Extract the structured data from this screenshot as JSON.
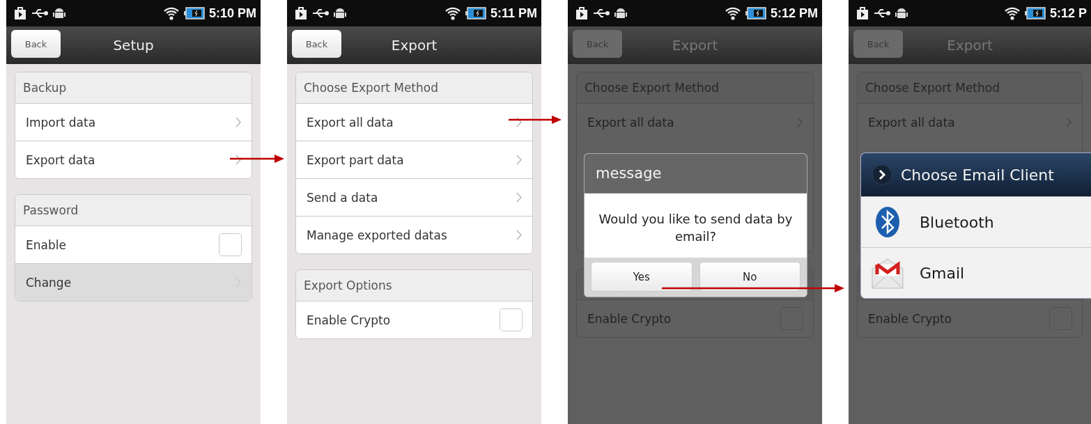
{
  "screens": [
    {
      "dimmed": false,
      "status_bar": {
        "time": "5:10 PM"
      },
      "title_bar": {
        "back": "Back",
        "title": "Setup"
      },
      "sections": [
        {
          "title": "Backup",
          "items": [
            {
              "kind": "link",
              "label": "Import data",
              "disabled": false
            },
            {
              "kind": "link",
              "label": "Export data",
              "disabled": false
            }
          ]
        },
        {
          "title": "Password",
          "items": [
            {
              "kind": "checkbox",
              "label": "Enable",
              "checked": false
            },
            {
              "kind": "link",
              "label": "Change",
              "disabled": true
            }
          ]
        }
      ]
    },
    {
      "dimmed": false,
      "status_bar": {
        "time": "5:11 PM"
      },
      "title_bar": {
        "back": "Back",
        "title": "Export"
      },
      "sections": [
        {
          "title": "Choose Export Method",
          "items": [
            {
              "kind": "link",
              "label": "Export all data",
              "disabled": false
            },
            {
              "kind": "link",
              "label": "Export part data",
              "disabled": false
            },
            {
              "kind": "link",
              "label": "Send a data",
              "disabled": false
            },
            {
              "kind": "link",
              "label": "Manage exported datas",
              "disabled": false
            }
          ]
        },
        {
          "title": "Export Options",
          "items": [
            {
              "kind": "checkbox",
              "label": "Enable Crypto",
              "checked": false
            }
          ]
        }
      ]
    },
    {
      "dimmed": true,
      "status_bar": {
        "time": "5:12 PM"
      },
      "title_bar": {
        "back": "Back",
        "title": "Export"
      },
      "sections": [
        {
          "title": "Choose Export Method",
          "items": [
            {
              "kind": "link",
              "label": "Export all data",
              "disabled": false
            }
          ]
        },
        {
          "items": [
            {
              "kind": "checkbox",
              "label": "Enable Crypto",
              "checked": false
            }
          ]
        }
      ],
      "dialog": {
        "title": "message",
        "text": "Would you like to send data by email?",
        "buttons": [
          "Yes",
          "No"
        ]
      }
    },
    {
      "dimmed": true,
      "status_bar": {
        "time": "5:12 P"
      },
      "title_bar": {
        "back": "Back",
        "title": "Export"
      },
      "sections": [
        {
          "title": "Choose Export Method",
          "items": [
            {
              "kind": "link",
              "label": "Export all data",
              "disabled": false
            }
          ]
        },
        {
          "items": [
            {
              "kind": "checkbox",
              "label": "Enable Crypto",
              "checked": false
            }
          ]
        }
      ],
      "chooser": {
        "title": "Choose Email Client",
        "items": [
          {
            "kind": "bluetooth",
            "label": "Bluetooth"
          },
          {
            "kind": "gmail",
            "label": "Gmail"
          }
        ]
      }
    }
  ]
}
